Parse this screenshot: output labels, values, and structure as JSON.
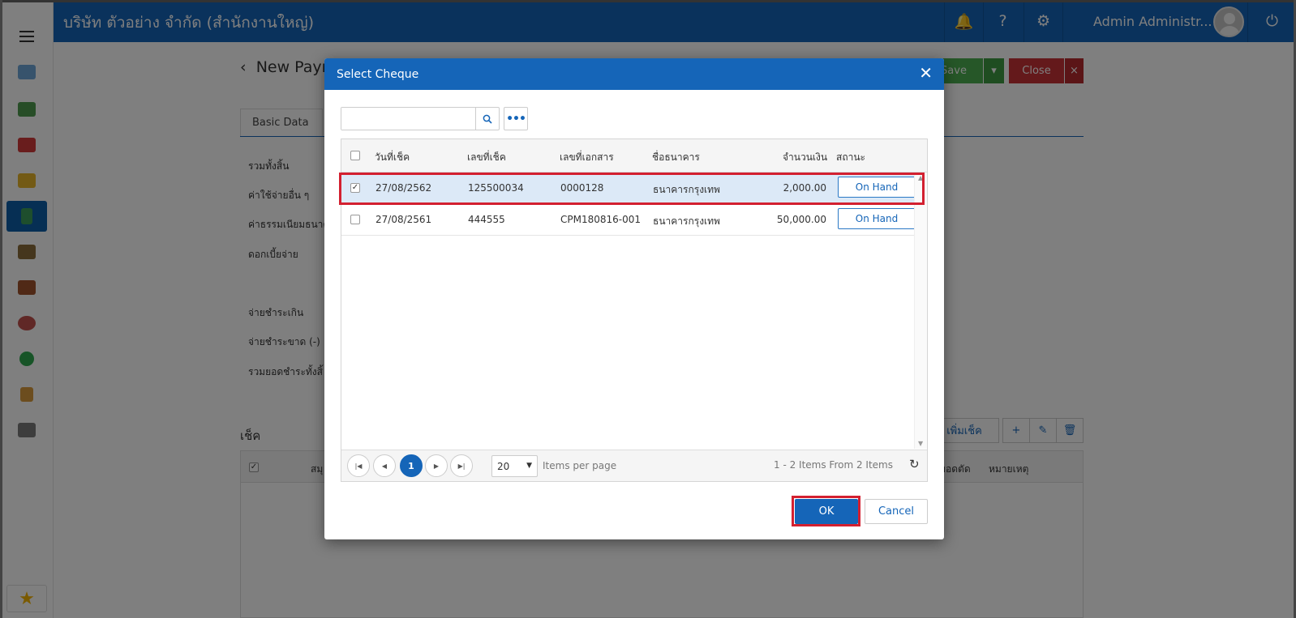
{
  "topbar": {
    "company": "บริษัท ตัวอย่าง จำกัด (สำนักงานใหญ่)",
    "user": "Admin Administr...",
    "icons": [
      "bell-icon",
      "help-icon",
      "gear-icon",
      "power-icon"
    ]
  },
  "sidebar": {
    "items": [
      "dashboard-icon",
      "money-icon",
      "cart-icon",
      "box-icon",
      "book-icon",
      "bank-icon",
      "wallet-icon",
      "person-icon",
      "check-circle-icon",
      "document-icon",
      "tools-icon"
    ],
    "active_index": 4
  },
  "page": {
    "title": "New Paym",
    "save_label": "Save",
    "close_label": "Close",
    "tab_basic": "Basic Data",
    "form_labels": [
      "รวมทั้งสิ้น",
      "ค่าใช้จ่ายอื่น ๆ",
      "ค่าธรรมเนียมธนาค",
      "ดอกเบี้ยจ่าย",
      "จ่ายชำระเกิน",
      "จ่ายชำระขาด (-)",
      "รวมยอดชำระทั้งสิ้"
    ],
    "section_title": "เช็ค",
    "add_cheque_label": "เพิ่มเช็ค",
    "grid_headers": [
      "สมุ",
      "ยอดตัด",
      "หมายเหตุ"
    ]
  },
  "modal": {
    "title": "Select Cheque",
    "search": {
      "value": "",
      "placeholder": ""
    },
    "columns": [
      "วันที่เช็ค",
      "เลขที่เช็ค",
      "เลขที่เอกสาร",
      "ชื่อธนาคาร",
      "จำนวนเงิน",
      "สถานะ"
    ],
    "rows": [
      {
        "date": "27/08/2562",
        "cheque_no": "125500034",
        "doc_no": "0000128",
        "bank": "ธนาคารกรุงเทพ",
        "amount": "2,000.00",
        "status": "On Hand",
        "checked": true
      },
      {
        "date": "27/08/2561",
        "cheque_no": "444555",
        "doc_no": "CPM180816-001",
        "bank": "ธนาคารกรุงเทพ",
        "amount": "50,000.00",
        "status": "On Hand",
        "checked": false
      }
    ],
    "pager": {
      "current_page": "1",
      "page_size": "20",
      "items_per_page_label": "Items per page",
      "info": "1 - 2 Items From 2 Items"
    },
    "ok_label": "OK",
    "cancel_label": "Cancel"
  },
  "colors": {
    "primary": "#1565b8",
    "danger": "#c93236",
    "save_green": "#4caf50",
    "highlight": "#d32030"
  }
}
